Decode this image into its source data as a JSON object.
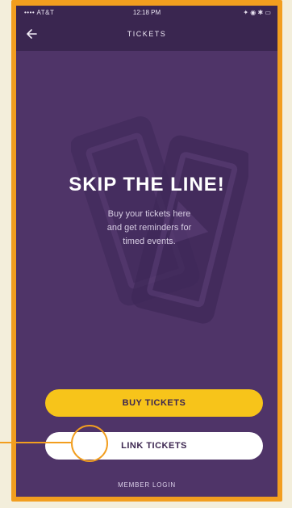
{
  "status_bar": {
    "carrier": "•••• AT&T ",
    "time": "12:18 PM",
    "icons": "✦ ◉ ✱ ▭"
  },
  "nav": {
    "title": "TICKETS",
    "back_icon": "arrow-left-icon"
  },
  "hero": {
    "headline": "SKIP THE LINE!",
    "subtext": "Buy your tickets here and get reminders for timed events."
  },
  "buttons": {
    "buy": "BUY TICKETS",
    "link": "LINK TICKETS",
    "member": "MEMBER LOGIN"
  },
  "colors": {
    "background": "#4f3468",
    "navbar": "#3a2650",
    "buy_button": "#f7c41a",
    "link_button": "#ffffff",
    "frame": "#f29e1f"
  }
}
